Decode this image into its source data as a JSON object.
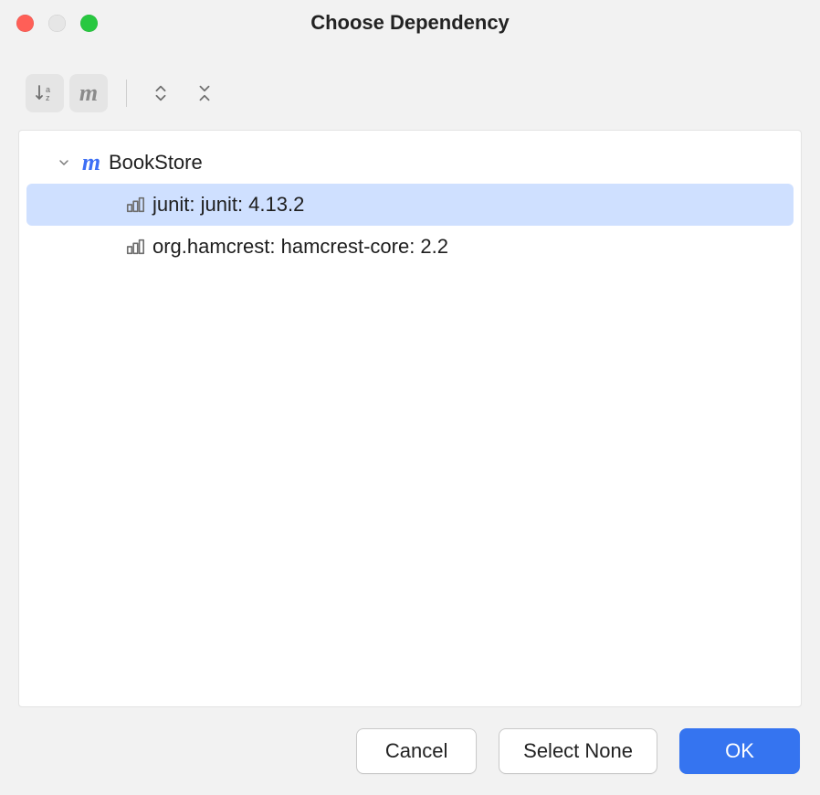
{
  "window": {
    "title": "Choose Dependency"
  },
  "toolbar": {
    "sort_az": {
      "name": "sort-alpha"
    },
    "maven_filter": {
      "name": "maven-filter"
    },
    "expand_all": {
      "name": "expand-all"
    },
    "collapse_all": {
      "name": "collapse-all"
    }
  },
  "tree": {
    "root": {
      "label": "BookStore",
      "expanded": true,
      "children": [
        {
          "label": "junit: junit: 4.13.2",
          "selected": true
        },
        {
          "label": "org.hamcrest: hamcrest-core: 2.2",
          "selected": false
        }
      ]
    }
  },
  "buttons": {
    "cancel": "Cancel",
    "select_none": "Select None",
    "ok": "OK"
  }
}
